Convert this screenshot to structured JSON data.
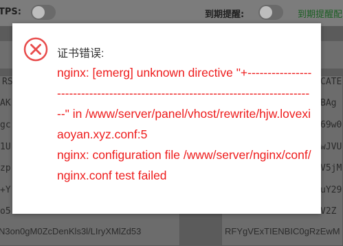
{
  "background": {
    "tps_label": "TPS:",
    "expiry_label": "到期提醒:",
    "expiry_green": "到期提醒配",
    "left_fragments": [
      "RS",
      "AK",
      "gc",
      "1U",
      "zp",
      "+Y",
      "o5"
    ],
    "right_fragments": [
      "CATE",
      "BAg",
      "69w0",
      "wJVU",
      "V5jM",
      "uY29",
      "V2Z"
    ],
    "left_bottom": "N3on0gM0ZcDenKls3l/LIryXMlZd53",
    "right_bottom": "RFYgVExTIENBIC0gRzEwM"
  },
  "dialog": {
    "icon": "error-x-circle-icon",
    "title": "证书错误:",
    "message": "nginx: [emerg] unknown directive \"+---------------------------------------------------------------------------------\" in /www/server/panel/vhost/rewrite/hjw.lovexiaoyan.xyz.conf:5\nnginx: configuration file /www/server/nginx/conf/nginx.conf test failed",
    "accent": "#ee1c1c"
  }
}
